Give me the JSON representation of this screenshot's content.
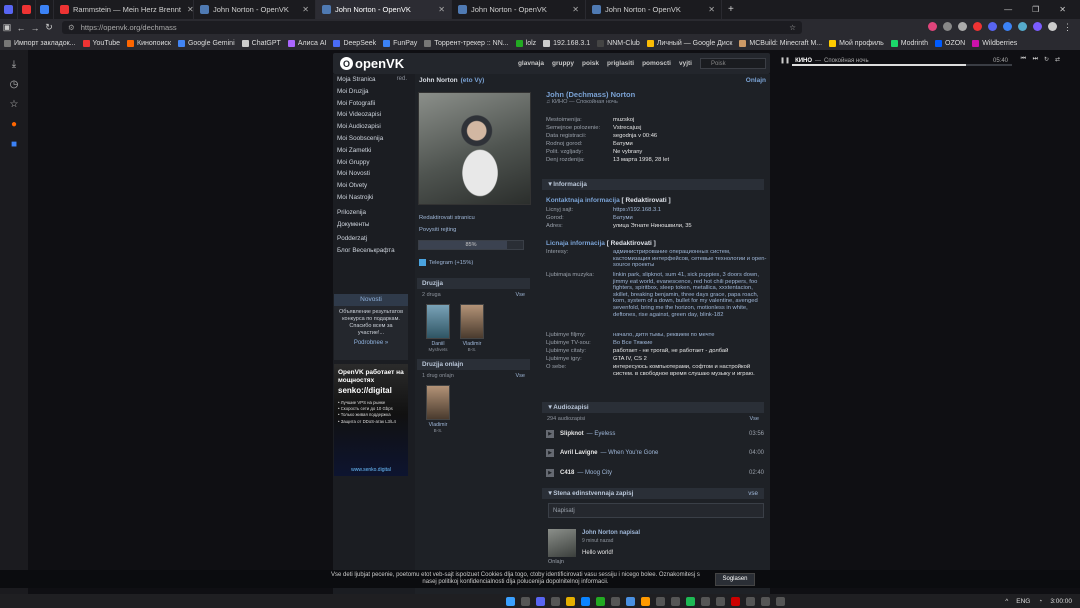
{
  "browser": {
    "tabs": [
      {
        "label": "",
        "pinned": true
      },
      {
        "label": "",
        "pinned": true
      },
      {
        "label": "Rammstein — Mein Herz Brennt",
        "pinned": false
      },
      {
        "label": "John Norton - OpenVK",
        "pinned": false
      },
      {
        "label": "John Norton - OpenVK",
        "pinned": false,
        "active": true
      },
      {
        "label": "John Norton - OpenVK",
        "pinned": false
      },
      {
        "label": "John Norton - OpenVK",
        "pinned": false
      }
    ],
    "url": "https://openvk.org/dechmass",
    "bookmarks": [
      "Импорт закладок...",
      "YouTube",
      "Кинопоиск",
      "Google Gemini",
      "ChatGPT",
      "Алиса AI",
      "DeepSeek",
      "FunPay",
      "Торрент-трекер :: NN...",
      "lolz",
      "192.168.3.1",
      "NNM-Club",
      "Личный — Google Диск",
      "MCBuild: Minecraft M...",
      "Мой профиль",
      "Modrinth",
      "OZON",
      "Wildberries"
    ]
  },
  "player": {
    "artist": "КИНО",
    "title": "Спокойная ночь",
    "time": "05:40",
    "progress": 0.79
  },
  "ovk": {
    "logo": "openVK",
    "menu": [
      "glavnaja",
      "gruppy",
      "poisk",
      "priglasiti",
      "pomoscti",
      "vyjti"
    ],
    "search_placeholder": "Poisk",
    "left_menu": {
      "red": "red.",
      "items": [
        "Moja Stranica",
        "Moi Druzjja",
        "Moi Fotografii",
        "Moi Videozapisi",
        "Moi Audiozapisi",
        "Moi Soobscenija",
        "Moi Zametki",
        "Moi Gruppy",
        "Moi Novosti",
        "Moi Otvety",
        "Moi Nastrojki"
      ],
      "extra": [
        "Prilozenija",
        "Документы"
      ],
      "extra2": [
        "Podderzatj",
        "Блог Веселькрафта"
      ]
    },
    "news": {
      "title": "Novosti",
      "text": "Объявление результатов конкурса по подаркам. Спасибо всем за участие!...",
      "more": "Podrobnee »"
    },
    "ad": {
      "line1": "OpenVK работает на мощностях",
      "brand": "senko://digital",
      "bullets": [
        "• Лучшие VPS на рынке",
        "• Скорость сети до 10 Gbps",
        "• Только живая поддержка",
        "• Защита от DDoS-атак L3/L4"
      ],
      "foot": "www.senko.digital"
    },
    "namebar": {
      "name": "John Norton",
      "self": "(eto Vy)",
      "online": "Onlajn"
    },
    "actions": [
      "Redaktirovati stranicu",
      "Povysiti rejting"
    ],
    "rating": "85%",
    "rating_fraction": 0.85,
    "telegram": "Telegram (+15%)",
    "friends": {
      "title": "Druzjja",
      "count": "2 druga",
      "all": "Vse",
      "list": [
        {
          "name": "Daniil",
          "sub": "Myshvets"
        },
        {
          "name": "Vladimir",
          "sub": "B-S."
        }
      ]
    },
    "friends_online": {
      "title": "Druzjja onlajn",
      "count": "1 drug onlajn",
      "all": "Vse",
      "list": [
        {
          "name": "Vladimir",
          "sub": "B-S."
        }
      ]
    },
    "profile": {
      "full_name": "John (Dechmass) Norton",
      "status": "КИНО — Спокойная ночь",
      "fields": [
        {
          "k": "Mestoimenija:",
          "v": "muzskoj"
        },
        {
          "k": "Semejnoe polozenie:",
          "v": "Vstrecajusj"
        },
        {
          "k": "Data registracii:",
          "v": "segodnja v 00:46"
        },
        {
          "k": "Rodnoj gorod:",
          "v": "Батуми"
        },
        {
          "k": "Polit. vzgljady:",
          "v": "Ne vybrany"
        },
        {
          "k": "Denj rozdenija:",
          "v": "13 марта 1998, 28 let"
        }
      ],
      "info_title": "Informacija",
      "contact_title": "Kontaktnaja informacija",
      "edit": "[ Redaktirovati ]",
      "contact": [
        {
          "k": "Licnyj sajt:",
          "v": "https://192.168.3.1"
        },
        {
          "k": "Gorod:",
          "v": "Батуми"
        },
        {
          "k": "Adres:",
          "v": "улица Эгнате Ниношвили, 35"
        }
      ],
      "personal_title": "Licnaja informacija",
      "personal": [
        {
          "k": "Interesy:",
          "v": "администрирование операционных систем, кастомизация интерфейсов, сетевые технологии и open-source проекты"
        },
        {
          "k": "Ljubimaja muzyka:",
          "v": "linkin park, slipknot, sum 41, sick puppies, 3 doors down, jimmy eat world, evanescence, red hot chili peppers, foo fighters, spiritbox, sleep token, metallica, xxxtentacion, skillet, breaking benjamin, three days grace, papa roach, korn, system of a down, bullet for my valentine, avenged sevenfold, bring me the horizon, motionless in white, deftones, rise against, green day, blink-182"
        },
        {
          "k": "Ljubimye filjmy:",
          "v": "начало, дитя тьмы, реквием по мечте"
        },
        {
          "k": "Ljubimye TV-sou:",
          "v": "Во Все Тяжкие"
        },
        {
          "k": "Ljubimye citaty:",
          "v": "работает - не трогай, не работает - долбай"
        },
        {
          "k": "Ljubimye igry:",
          "v": "GTA IV, CS 2"
        },
        {
          "k": "O sebe:",
          "v": "интересуюсь компьютерами, софтом и настройкой систем. в свободное время слушаю музыку и играю."
        }
      ]
    },
    "audio": {
      "title": "Audiozapisi",
      "count": "294 audiozapisi",
      "all": "Vse",
      "tracks": [
        {
          "artist": "Slipknot",
          "title": "Eyeless",
          "dur": "03:56"
        },
        {
          "artist": "Avril Lavigne",
          "title": "When You're Gone",
          "dur": "04:00"
        },
        {
          "artist": "C418",
          "title": "Moog City",
          "dur": "02:40"
        }
      ]
    },
    "wall": {
      "title": "Stena edinstvennaja zapisj",
      "all": "vse",
      "placeholder": "Napisatj",
      "post": {
        "author": "John Norton",
        "action": "napisal",
        "time": "9 minut nazad",
        "text": "Hello world!",
        "online": "Onlajn"
      }
    }
  },
  "cookie": {
    "text": "Vse deti ljubjat pecenie, poetomu etot veb-sajt ispolzuet Cookies dlja togo, ctoby identificirovati vasu sessiju i nicego bolee. Oznakomitesj s nasej politikoj konfidencialnosti dlja polucenija dopolnitelnoj informacii.",
    "button": "Soglasen"
  },
  "taskbar": {
    "lang": "ENG",
    "clock": "3:00:00"
  }
}
